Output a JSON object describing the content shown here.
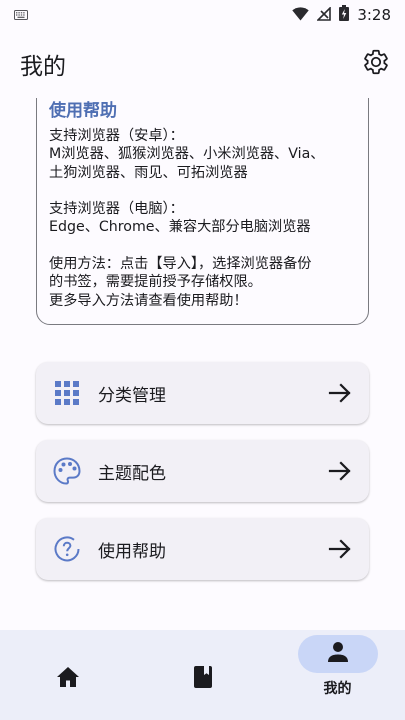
{
  "status_bar": {
    "time": "3:28",
    "icons": [
      "keyboard-icon",
      "wifi-icon",
      "no-signal-icon",
      "battery-charging-icon"
    ]
  },
  "app_bar": {
    "title": "我的",
    "settings_icon": "gear-icon"
  },
  "help_card": {
    "heading": "使用帮助",
    "lines": [
      "支持浏览器（安卓）：",
      "M浏览器、狐猴浏览器、小米浏览器、Via、",
      "土狗浏览器、雨见、可拓浏览器",
      "",
      "支持浏览器（电脑）：",
      "Edge、Chrome、兼容大部分电脑浏览器",
      "",
      "使用方法：点击【导入】，选择浏览器备份",
      "的书签，需要提前授予存储权限。",
      "更多导入方法请查看使用帮助！"
    ],
    "heading_color": "#4f6fb3"
  },
  "menu": {
    "items": [
      {
        "label": "分类管理",
        "icon": "grid-icon"
      },
      {
        "label": "主题配色",
        "icon": "palette-icon"
      },
      {
        "label": "使用帮助",
        "icon": "help-circle-icon"
      }
    ],
    "arrow_icon": "arrow-right-icon",
    "accent": "#4f6fb3"
  },
  "bottom_nav": {
    "items": [
      {
        "label": "",
        "icon": "home-icon",
        "active": false
      },
      {
        "label": "",
        "icon": "book-icon",
        "active": false
      },
      {
        "label": "我的",
        "icon": "person-icon",
        "active": true
      }
    ],
    "active_pill_color": "#c9d6f7"
  }
}
